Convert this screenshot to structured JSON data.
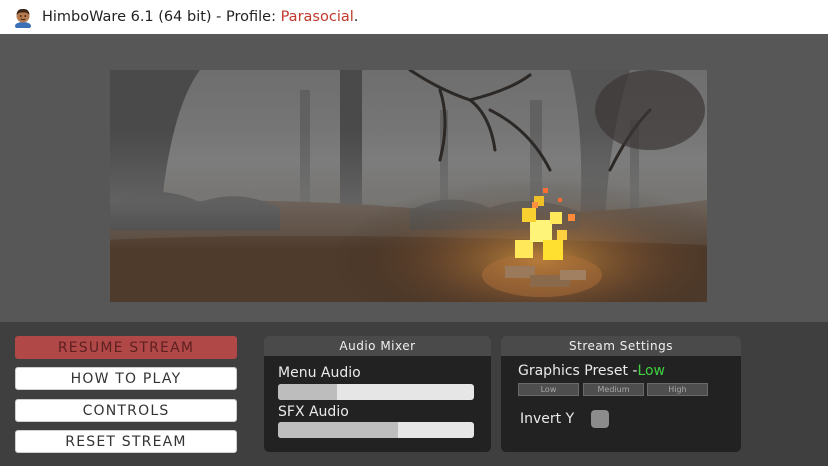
{
  "window": {
    "title_prefix": "HimboWare 6.1 (64 bit) - Profile: ",
    "profile": "Parasocial",
    "title_suffix": "."
  },
  "menu": {
    "buttons": [
      {
        "label": "RESUME STREAM",
        "active": true
      },
      {
        "label": "HOW TO PLAY",
        "active": false
      },
      {
        "label": "CONTROLS",
        "active": false
      },
      {
        "label": "RESET STREAM",
        "active": false
      }
    ]
  },
  "audio_mixer": {
    "title": "Audio Mixer",
    "sliders": [
      {
        "label": "Menu Audio",
        "value": 0.3
      },
      {
        "label": "SFX Audio",
        "value": 0.61
      }
    ]
  },
  "stream_settings": {
    "title": "Stream Settings",
    "graphics_label": "Graphics Preset -",
    "graphics_value": "Low",
    "graphics_value_color": "#3fd13f",
    "presets": [
      "Low",
      "Medium",
      "High"
    ],
    "invert_y_label": "Invert Y",
    "invert_y": false
  },
  "colors": {
    "resume_button": "#b14848",
    "profile_name": "#c0392b"
  }
}
